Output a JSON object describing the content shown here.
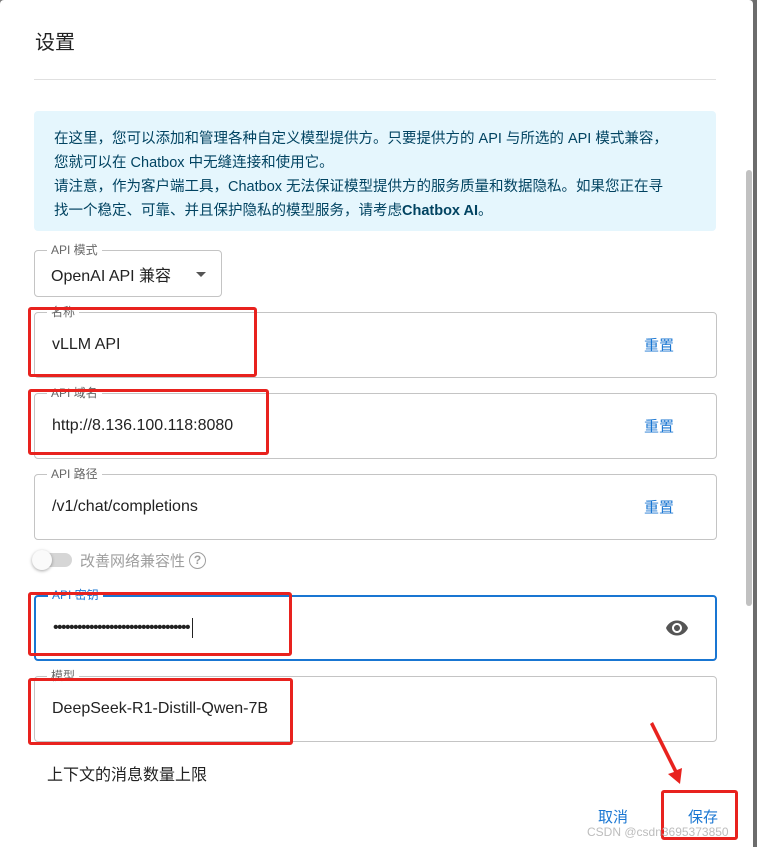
{
  "dialog": {
    "title": "设置"
  },
  "info": {
    "line1": "在这里，您可以添加和管理各种自定义模型提供方。只要提供方的 API 与所选的 API 模式兼容，",
    "line2": "您就可以在 Chatbox 中无缝连接和使用它。",
    "line3": "请注意，作为客户端工具，Chatbox 无法保证模型提供方的服务质量和数据隐私。如果您正在寻",
    "line4_prefix": "找一个稳定、可靠、并且保护隐私的模型服务，请考虑",
    "line4_bold": "Chatbox AI",
    "line4_suffix": "。"
  },
  "api_mode": {
    "label": "API 模式",
    "value": "OpenAI API 兼容"
  },
  "name_field": {
    "label": "名称",
    "value": "vLLM API",
    "reset_label": "重置"
  },
  "host_field": {
    "label": "API 域名",
    "value": "http://8.136.100.118:8080",
    "reset_label": "重置"
  },
  "path_field": {
    "label": "API 路径",
    "value": "/v1/chat/completions",
    "reset_label": "重置"
  },
  "network_toggle": {
    "label": "改善网络兼容性",
    "help": "?"
  },
  "key_field": {
    "label": "API 密钥",
    "value": "••••••••••••••••••••••••••••••••••"
  },
  "model_field": {
    "label": "模型",
    "value": "DeepSeek-R1-Distill-Qwen-7B"
  },
  "context": {
    "label": "上下文的消息数量上限"
  },
  "actions": {
    "cancel_label": "取消",
    "save_label": "保存"
  },
  "watermark": {
    "text": "CSDN @csdn3695373850"
  },
  "colors": {
    "accent": "#1976d2",
    "info_bg": "#e5f6fd",
    "annotation": "#e8221e"
  }
}
